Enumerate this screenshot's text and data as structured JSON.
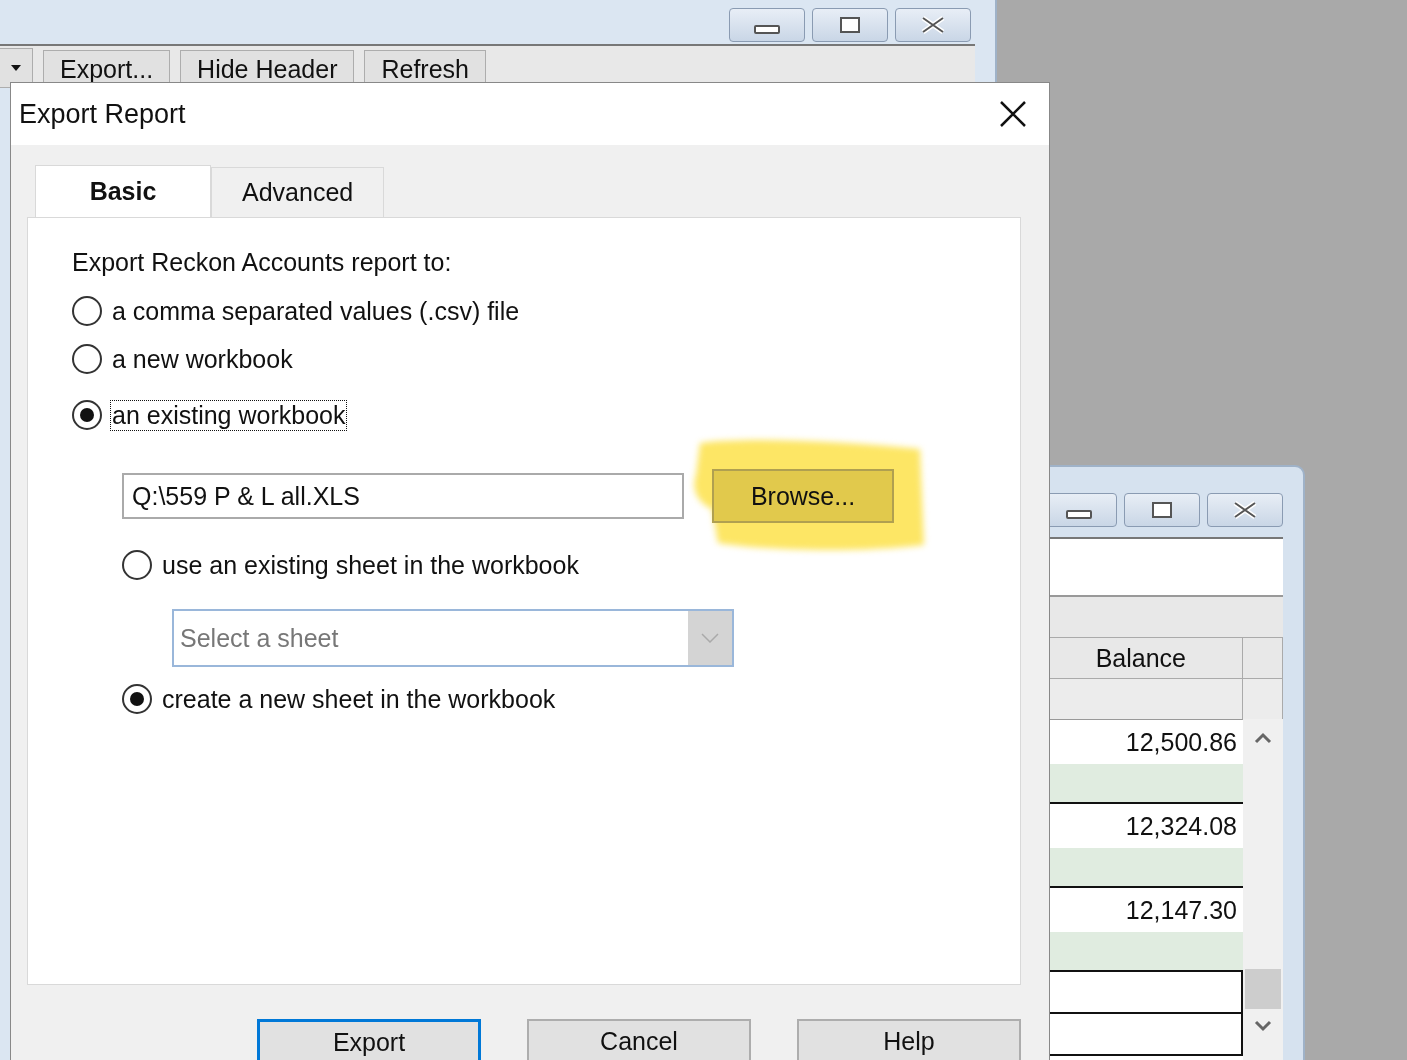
{
  "back_window": {
    "toolbar": [
      {
        "label": "Export..."
      },
      {
        "label": "Hide Header"
      },
      {
        "label": "Refresh"
      }
    ]
  },
  "report_window": {
    "column_header": "Balance",
    "rows": [
      {
        "kind": "value",
        "balance": "12,500.86"
      },
      {
        "kind": "band"
      },
      {
        "kind": "value",
        "balance": "12,324.08"
      },
      {
        "kind": "band"
      },
      {
        "kind": "value",
        "balance": "12,147.30"
      },
      {
        "kind": "band"
      },
      {
        "kind": "blank"
      },
      {
        "kind": "blank"
      }
    ]
  },
  "dialog": {
    "title": "Export Report",
    "tabs": [
      {
        "label": "Basic",
        "selected": true
      },
      {
        "label": "Advanced",
        "selected": false
      }
    ],
    "prompt": "Export Reckon Accounts report to:",
    "destinations": [
      {
        "label": "a comma separated values (.csv) file",
        "selected": false,
        "focused": false
      },
      {
        "label": "a new workbook",
        "selected": false,
        "focused": false
      },
      {
        "label": "an existing workbook",
        "selected": true,
        "focused": true
      }
    ],
    "file_path": "Q:\\559 P & L all.XLS",
    "browse_button": {
      "label": "Browse...",
      "highlighted": true
    },
    "sheet_options": [
      {
        "kind": "existing",
        "label": "use an existing sheet in the workbook",
        "selected": false
      },
      {
        "kind": "new",
        "label": "create a new sheet in the workbook",
        "selected": true
      }
    ],
    "sheet_select": {
      "placeholder": "Select a sheet",
      "disabled": true
    },
    "buttons": [
      {
        "label": "Export",
        "default": true
      },
      {
        "label": "Cancel",
        "default": false
      },
      {
        "label": "Help",
        "default": false
      }
    ]
  }
}
